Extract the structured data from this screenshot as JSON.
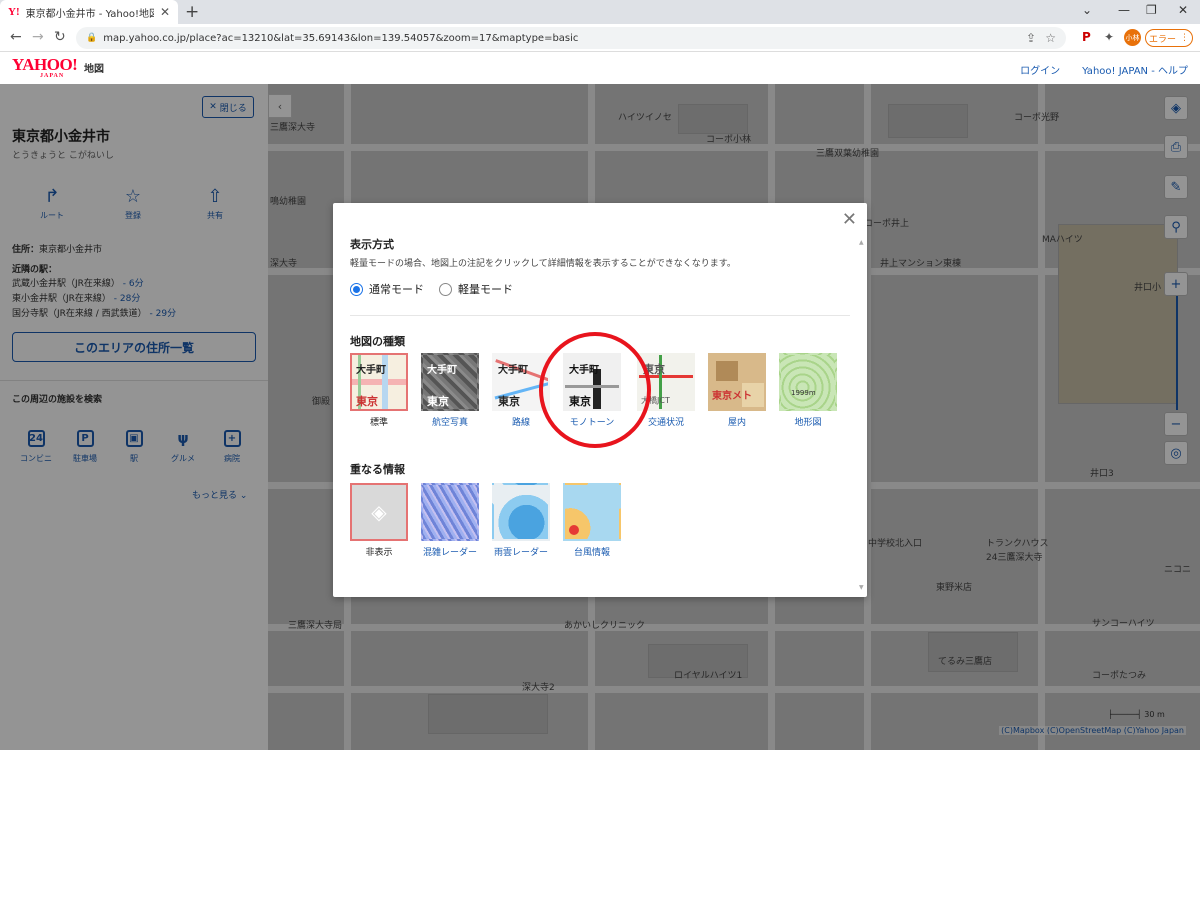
{
  "browser": {
    "tab_title": "東京都小金井市 - Yahoo!地図",
    "favicon_text": "Y!",
    "url": "map.yahoo.co.jp/place?ac=13210&lat=35.69143&lon=139.54057&zoom=17&maptype=basic",
    "error_label": "エラー",
    "profile_label": "小林"
  },
  "header": {
    "logo": "YAHOO!",
    "logo_sub": "JAPAN",
    "service": "地図",
    "login": "ログイン",
    "yahoo_japan": "Yahoo! JAPAN",
    "help": "ヘルプ"
  },
  "panel": {
    "close_label": "閉じる",
    "title": "東京都小金井市",
    "reading": "とうきょうと こがねいし",
    "actions": [
      "ルート",
      "登録",
      "共有"
    ],
    "address_label": "住所：",
    "address": "東京都小金井市",
    "stations_label": "近隣の駅：",
    "stations": [
      {
        "name": "武蔵小金井駅（JR在来線）",
        "time": "- 6分"
      },
      {
        "name": "東小金井駅（JR在来線）",
        "time": "- 28分"
      },
      {
        "name": "国分寺駅（JR在来線 / 西武鉄道）",
        "time": "- 29分"
      }
    ],
    "area_button": "このエリアの住所一覧",
    "search_heading": "この周辺の施設を検索",
    "facilities": [
      "コンビニ",
      "駐車場",
      "駅",
      "グルメ",
      "病院"
    ],
    "more": "もっと見る"
  },
  "map": {
    "labels": [
      "三鷹深大寺",
      "ハイツイノセ",
      "コーポ小林",
      "コーポ光野",
      "三鷹双葉幼稚園",
      "鳴幼稚園",
      "コーポ井上",
      "MAハイツ",
      "深大寺",
      "井上マンション東棟",
      "井口小",
      "御殿",
      "井口3",
      "トランクハウス",
      "24三鷹深大寺",
      "中学校北入口",
      "東野米店",
      "ニコニ",
      "三鷹深大寺局",
      "あかいしクリニック",
      "サンコーハイツ",
      "てるみ三鷹店",
      "コーポたつみ",
      "ロイヤルハイツ1",
      "深大寺2"
    ],
    "scale": "30 m",
    "attribution": "(C)Mapbox (C)OpenStreetMap (C)Yahoo Japan"
  },
  "modal": {
    "display_heading": "表示方式",
    "display_desc": "軽量モードの場合、地図上の注記をクリックして詳細情報を表示することができなくなります。",
    "mode_normal": "通常モード",
    "mode_light": "軽量モード",
    "map_type_heading": "地図の種類",
    "map_types": [
      "標準",
      "航空写真",
      "路線",
      "モノトーン",
      "交通状況",
      "屋内",
      "地形図"
    ],
    "overlay_heading": "重なる情報",
    "overlays": [
      "非表示",
      "混雑レーダー",
      "雨雲レーダー",
      "台風情報"
    ],
    "thumb_text": {
      "top": "大手町",
      "bottom": "東京",
      "tokyo": "東京",
      "metro": "東京メト",
      "jct": "大橋JCT",
      "elev": "1999m"
    }
  }
}
